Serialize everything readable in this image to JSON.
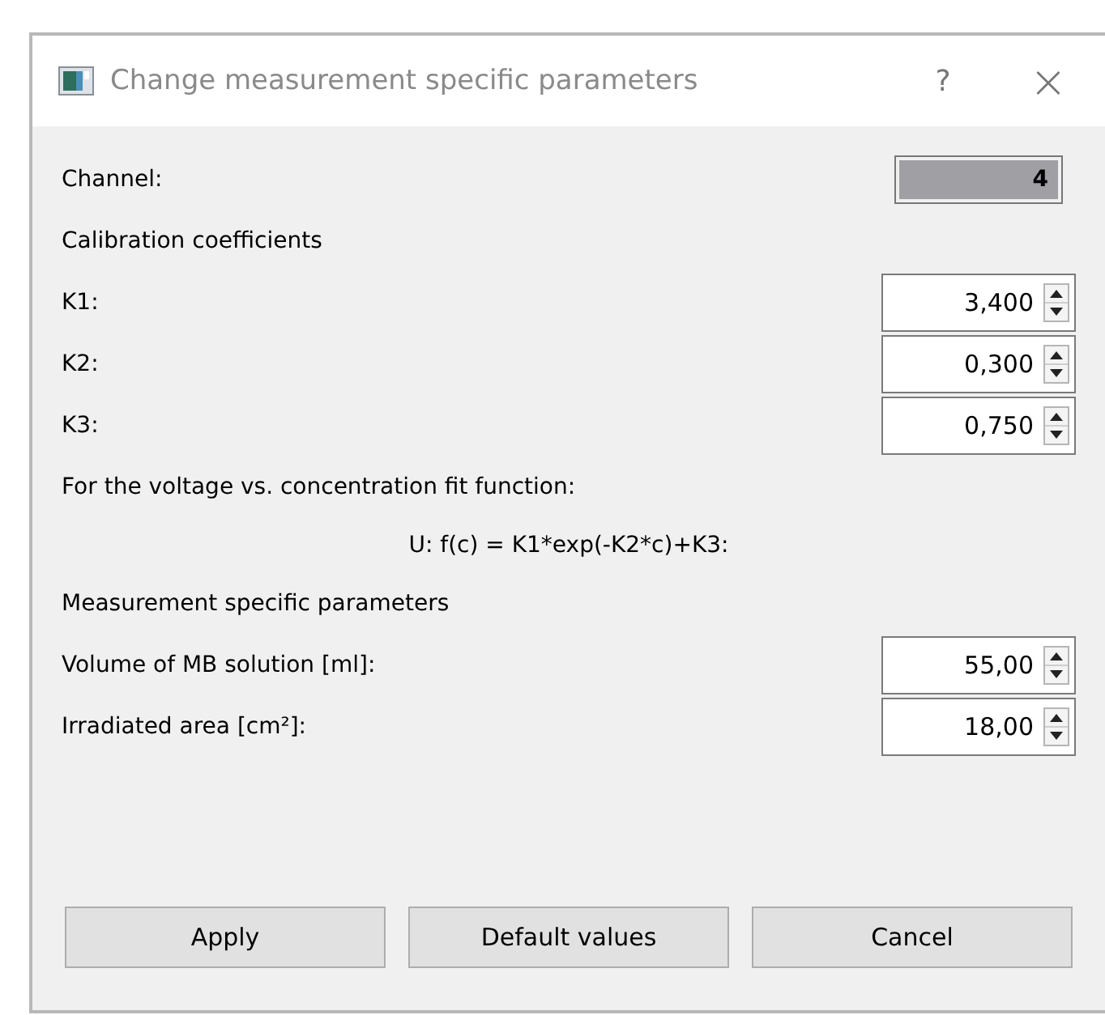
{
  "window": {
    "title": "Change measurement specific parameters",
    "help": "?",
    "close": "×"
  },
  "rows": [
    {
      "kind": "readonly",
      "label": "Channel:",
      "value": "4"
    },
    {
      "kind": "heading",
      "label": "Calibration coefficients"
    },
    {
      "kind": "spin",
      "label": "K1:",
      "value": "3,400"
    },
    {
      "kind": "spin",
      "label": "K2:",
      "value": "0,300"
    },
    {
      "kind": "spin",
      "label": "K3:",
      "value": "0,750"
    },
    {
      "kind": "heading",
      "label": "For the voltage vs. concentration fit function:"
    },
    {
      "kind": "formula",
      "label": "U: f(c) = K1*exp(-K2*c)+K3:"
    },
    {
      "kind": "heading",
      "label": "Measurement specific parameters"
    },
    {
      "kind": "spin",
      "label": "Volume of MB solution [ml]:",
      "value": "55,00"
    },
    {
      "kind": "spin",
      "label": "Irradiated area [cm²]:",
      "value": "18,00"
    }
  ],
  "buttons": [
    "Apply",
    "Default values",
    "Cancel"
  ]
}
